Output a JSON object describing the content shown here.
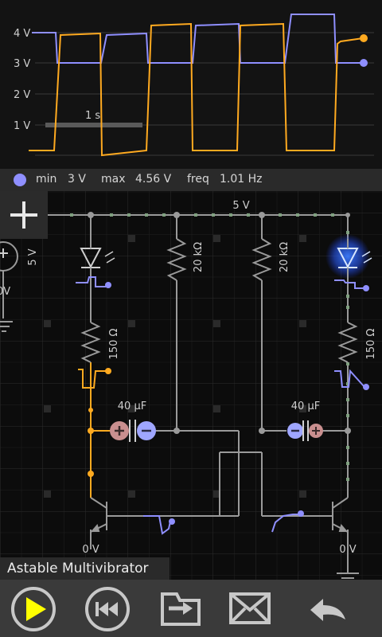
{
  "scope": {
    "y_ticks": [
      "4 V",
      "3 V",
      "2 V",
      "1 V"
    ],
    "time_scale_label": "1 s",
    "colors": {
      "trace_base": "#8f8fff",
      "trace_led": "#ffaa20",
      "grid": "#3a3a3a"
    }
  },
  "readout": {
    "min_label": "min",
    "min_value": "3 V",
    "max_label": "max",
    "max_value": "4.56 V",
    "freq_label": "freq",
    "freq_value": "1.01 Hz"
  },
  "circuit": {
    "supply_label": "5 V",
    "source_voltage": "5 V",
    "source_partial": "0V",
    "r_left": "150 Ω",
    "r_mid_left": "20 kΩ",
    "r_mid_right": "20 kΩ",
    "r_right": "150 Ω",
    "c_left": "40 µF",
    "c_right": "40 µF",
    "ground_left": "0 V",
    "ground_right": "0 V",
    "colors": {
      "wire": "#9a9a9a",
      "active": "#ffaa20",
      "selected": "#3d7dff",
      "node": "#8f8fff"
    }
  },
  "title": "Astable Multivibrator",
  "toolbar": {
    "icons": [
      "play-icon",
      "rewind-icon",
      "open-folder-icon",
      "email-icon",
      "undo-icon"
    ]
  }
}
